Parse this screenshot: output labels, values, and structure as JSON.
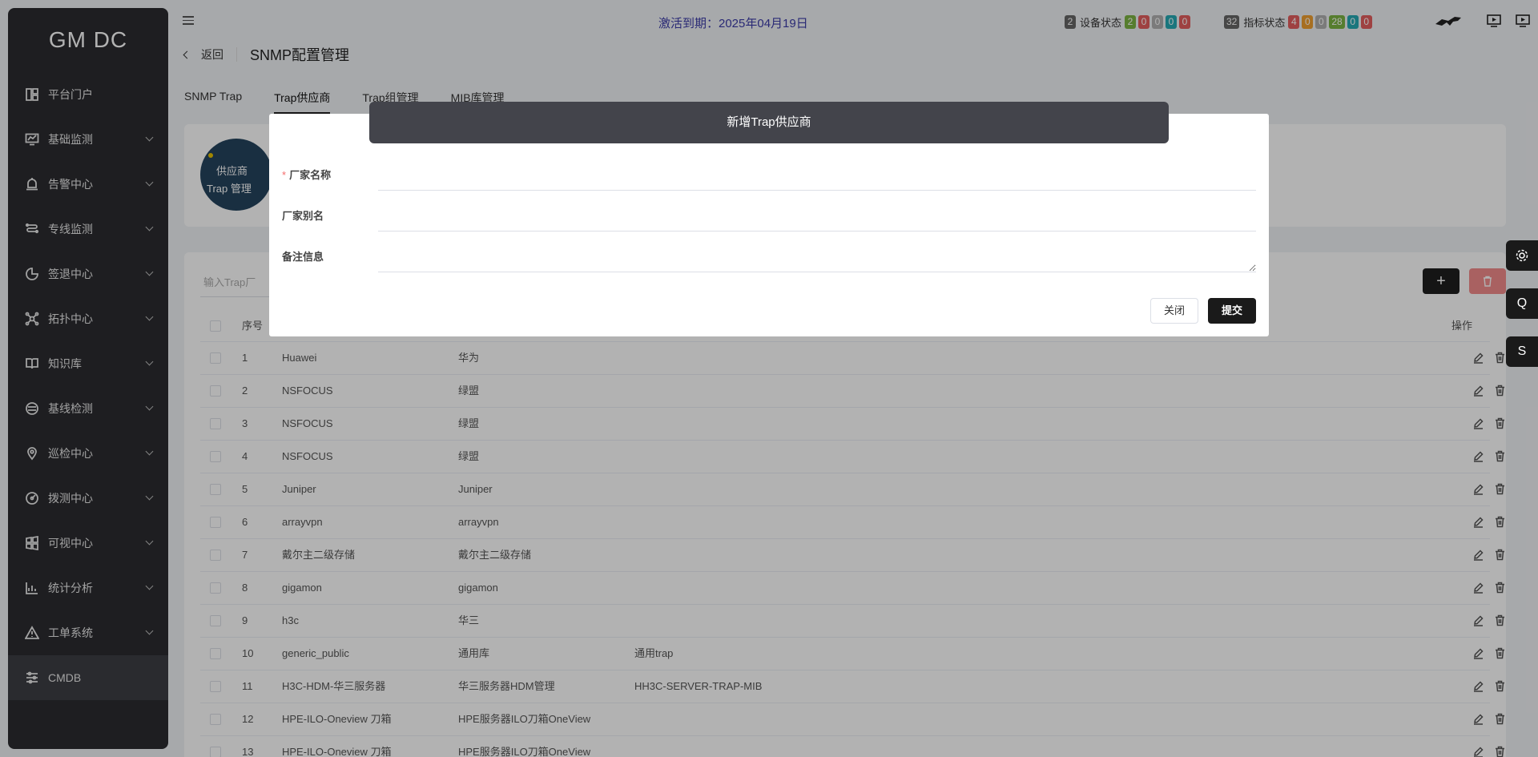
{
  "app": {
    "logo": "GM DC"
  },
  "sidebar": {
    "items": [
      {
        "label": "平台门户",
        "icon": "dashboard-icon",
        "arrow": false
      },
      {
        "label": "基础监测",
        "icon": "monitor-icon",
        "arrow": true
      },
      {
        "label": "告警中心",
        "icon": "alarm-icon",
        "arrow": true
      },
      {
        "label": "专线监测",
        "icon": "line-icon",
        "arrow": true
      },
      {
        "label": "签退中心",
        "icon": "pie-icon",
        "arrow": true
      },
      {
        "label": "拓扑中心",
        "icon": "topology-icon",
        "arrow": true
      },
      {
        "label": "知识库",
        "icon": "book-icon",
        "arrow": true
      },
      {
        "label": "基线检测",
        "icon": "baseline-icon",
        "arrow": true
      },
      {
        "label": "巡检中心",
        "icon": "location-icon",
        "arrow": true
      },
      {
        "label": "拨测中心",
        "icon": "dial-icon",
        "arrow": true
      },
      {
        "label": "可视中心",
        "icon": "windows-icon",
        "arrow": true
      },
      {
        "label": "统计分析",
        "icon": "chart-icon",
        "arrow": true
      },
      {
        "label": "工单系统",
        "icon": "warning-icon",
        "arrow": true
      },
      {
        "label": "CMDB",
        "icon": "sliders-icon",
        "arrow": false
      }
    ]
  },
  "topbar": {
    "expire_text": "激活到期：2025年04月19日",
    "device_status": {
      "count": "2",
      "label": "设备状态",
      "badges": [
        "2",
        "0",
        "0",
        "0",
        "0"
      ]
    },
    "metric_status": {
      "count": "32",
      "label": "指标状态",
      "badges": [
        "4",
        "0",
        "0",
        "28",
        "0",
        "0"
      ]
    }
  },
  "page": {
    "back_label": "返回",
    "title": "SNMP配置管理",
    "tabs": [
      "SNMP Trap",
      "Trap供应商",
      "Trap组管理",
      "MIB库管理"
    ],
    "active_tab": 1
  },
  "infocard": {
    "line1": "供应商",
    "line2": "Trap 管理"
  },
  "table": {
    "search_placeholder": "输入Trap厂",
    "headers": {
      "index": "序号",
      "ops": "操作"
    },
    "rows": [
      [
        "1",
        "Huawei",
        "华为",
        ""
      ],
      [
        "2",
        "NSFOCUS",
        "绿盟",
        ""
      ],
      [
        "3",
        "NSFOCUS",
        "绿盟",
        ""
      ],
      [
        "4",
        "NSFOCUS",
        "绿盟",
        ""
      ],
      [
        "5",
        "Juniper",
        "Juniper",
        ""
      ],
      [
        "6",
        "arrayvpn",
        "arrayvpn",
        ""
      ],
      [
        "7",
        "戴尔主二级存储",
        "戴尔主二级存储",
        ""
      ],
      [
        "8",
        "gigamon",
        "gigamon",
        ""
      ],
      [
        "9",
        "h3c",
        "华三",
        ""
      ],
      [
        "10",
        "generic_public",
        "通用库",
        "通用trap"
      ],
      [
        "11",
        "H3C-HDM-华三服务器",
        "华三服务器HDM管理",
        "HH3C-SERVER-TRAP-MIB"
      ],
      [
        "12",
        "HPE-ILO-Oneview 刀箱",
        "HPE服务器ILO刀箱OneView",
        ""
      ],
      [
        "13",
        "HPE-ILO-Oneview 刀箱",
        "HPE服务器ILO刀箱OneView",
        ""
      ]
    ]
  },
  "float_buttons": [
    "Q",
    "S"
  ],
  "dialog": {
    "title": "新增Trap供应商",
    "fields": [
      {
        "label": "厂家名称",
        "required": true,
        "value": ""
      },
      {
        "label": "厂家别名",
        "required": false,
        "value": ""
      },
      {
        "label": "备注信息",
        "required": false,
        "value": ""
      }
    ],
    "close_label": "关闭",
    "submit_label": "提交"
  },
  "colors": {
    "green": "#7cb342",
    "red": "#e35d5d",
    "gray": "#b0b0b0",
    "teal": "#26a9b3",
    "orange": "#f0a030",
    "dark": "#666666"
  }
}
